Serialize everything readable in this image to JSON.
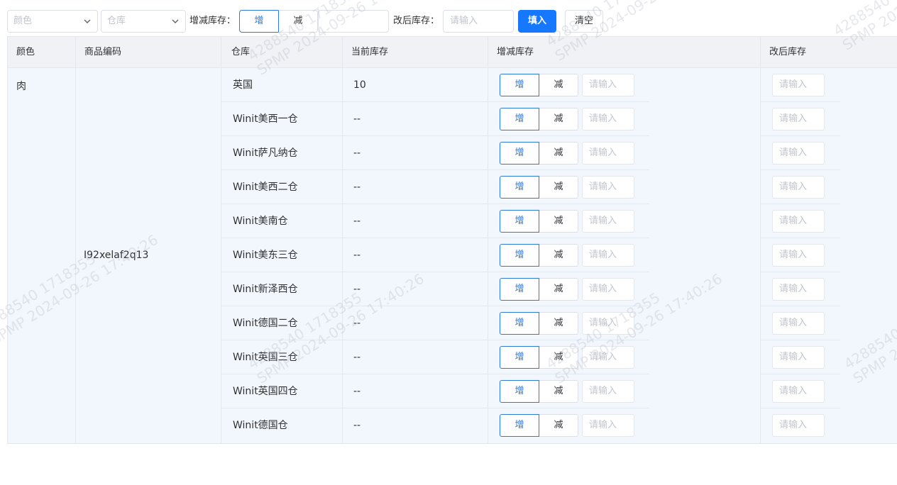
{
  "toolbar": {
    "color_select_placeholder": "颜色",
    "warehouse_select_placeholder": "仓库",
    "adjust_label": "增减库存：",
    "increase_label": "增",
    "decrease_label": "减",
    "adjust_value": "",
    "after_label": "改后库存：",
    "after_placeholder": "请输入",
    "fill_button": "填入",
    "clear_button": "清空"
  },
  "table": {
    "headers": {
      "color": "颜色",
      "sku": "商品编码",
      "warehouse": "仓库",
      "current_stock": "当前库存",
      "adjust_stock": "增减库存",
      "after_stock": "改后库存"
    },
    "color": "肉",
    "sku": "I92xelaf2q13",
    "row_increase_label": "增",
    "row_decrease_label": "减",
    "input_placeholder": "请输入",
    "rows": [
      {
        "warehouse": "英国",
        "current": "10"
      },
      {
        "warehouse": "Winit美西一仓",
        "current": "--"
      },
      {
        "warehouse": "Winit萨凡纳仓",
        "current": "--"
      },
      {
        "warehouse": "Winit美西二仓",
        "current": "--"
      },
      {
        "warehouse": "Winit美南仓",
        "current": "--"
      },
      {
        "warehouse": "Winit美东三仓",
        "current": "--"
      },
      {
        "warehouse": "Winit新泽西仓",
        "current": "--"
      },
      {
        "warehouse": "Winit德国二仓",
        "current": "--"
      },
      {
        "warehouse": "Winit英国三仓",
        "current": "--"
      },
      {
        "warehouse": "Winit英国四仓",
        "current": "--"
      },
      {
        "warehouse": "Winit德国仓",
        "current": "--"
      }
    ]
  },
  "watermark": {
    "line1": "4288540 1718355",
    "line2": "SPMP 2024-09-26 17:40:26"
  }
}
